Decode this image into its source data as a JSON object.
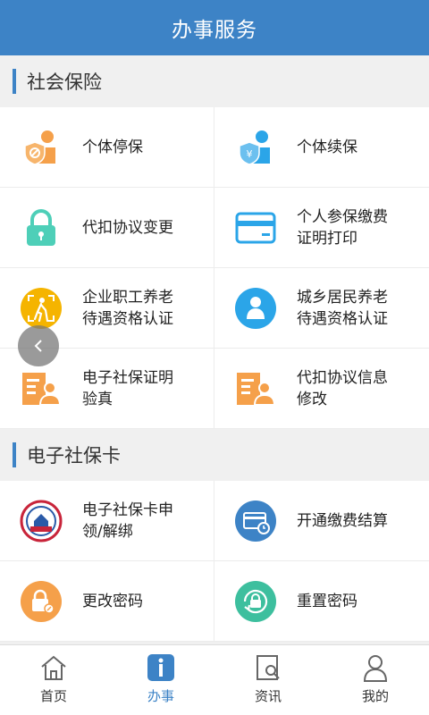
{
  "header": {
    "title": "办事服务"
  },
  "sections": [
    {
      "title": "社会保险",
      "items": [
        {
          "label": "个体停保",
          "icon": "person-stop-icon"
        },
        {
          "label": "个体续保",
          "icon": "person-yuan-shield-icon"
        },
        {
          "label": "代扣协议变更",
          "icon": "lock-icon"
        },
        {
          "label": "个人参保缴费\n证明打印",
          "icon": "card-icon"
        },
        {
          "label": "企业职工养老\n待遇资格认证",
          "icon": "elderly-scan-icon"
        },
        {
          "label": "城乡居民养老\n待遇资格认证",
          "icon": "user-circle-icon"
        },
        {
          "label": "电子社保证明\n验真",
          "icon": "document-person-icon"
        },
        {
          "label": "代扣协议信息\n修改",
          "icon": "document-person-icon"
        }
      ]
    },
    {
      "title": "电子社保卡",
      "items": [
        {
          "label": "电子社保卡申\n领/解绑",
          "icon": "social-security-seal-icon"
        },
        {
          "label": "开通缴费结算",
          "icon": "card-clock-icon"
        },
        {
          "label": "更改密码",
          "icon": "lock-edit-icon"
        },
        {
          "label": "重置密码",
          "icon": "lock-reset-icon"
        }
      ]
    }
  ],
  "tabbar": {
    "items": [
      {
        "label": "首页",
        "icon": "home-icon"
      },
      {
        "label": "办事",
        "icon": "info-icon"
      },
      {
        "label": "资讯",
        "icon": "news-search-icon"
      },
      {
        "label": "我的",
        "icon": "profile-icon"
      }
    ],
    "active_index": 1
  },
  "colors": {
    "header": "#3d83c6",
    "accent": "#3d83c6",
    "orange": "#f5a04a",
    "teal": "#4ecfb8",
    "blue": "#2ba5e8",
    "yellow": "#f5b400"
  }
}
